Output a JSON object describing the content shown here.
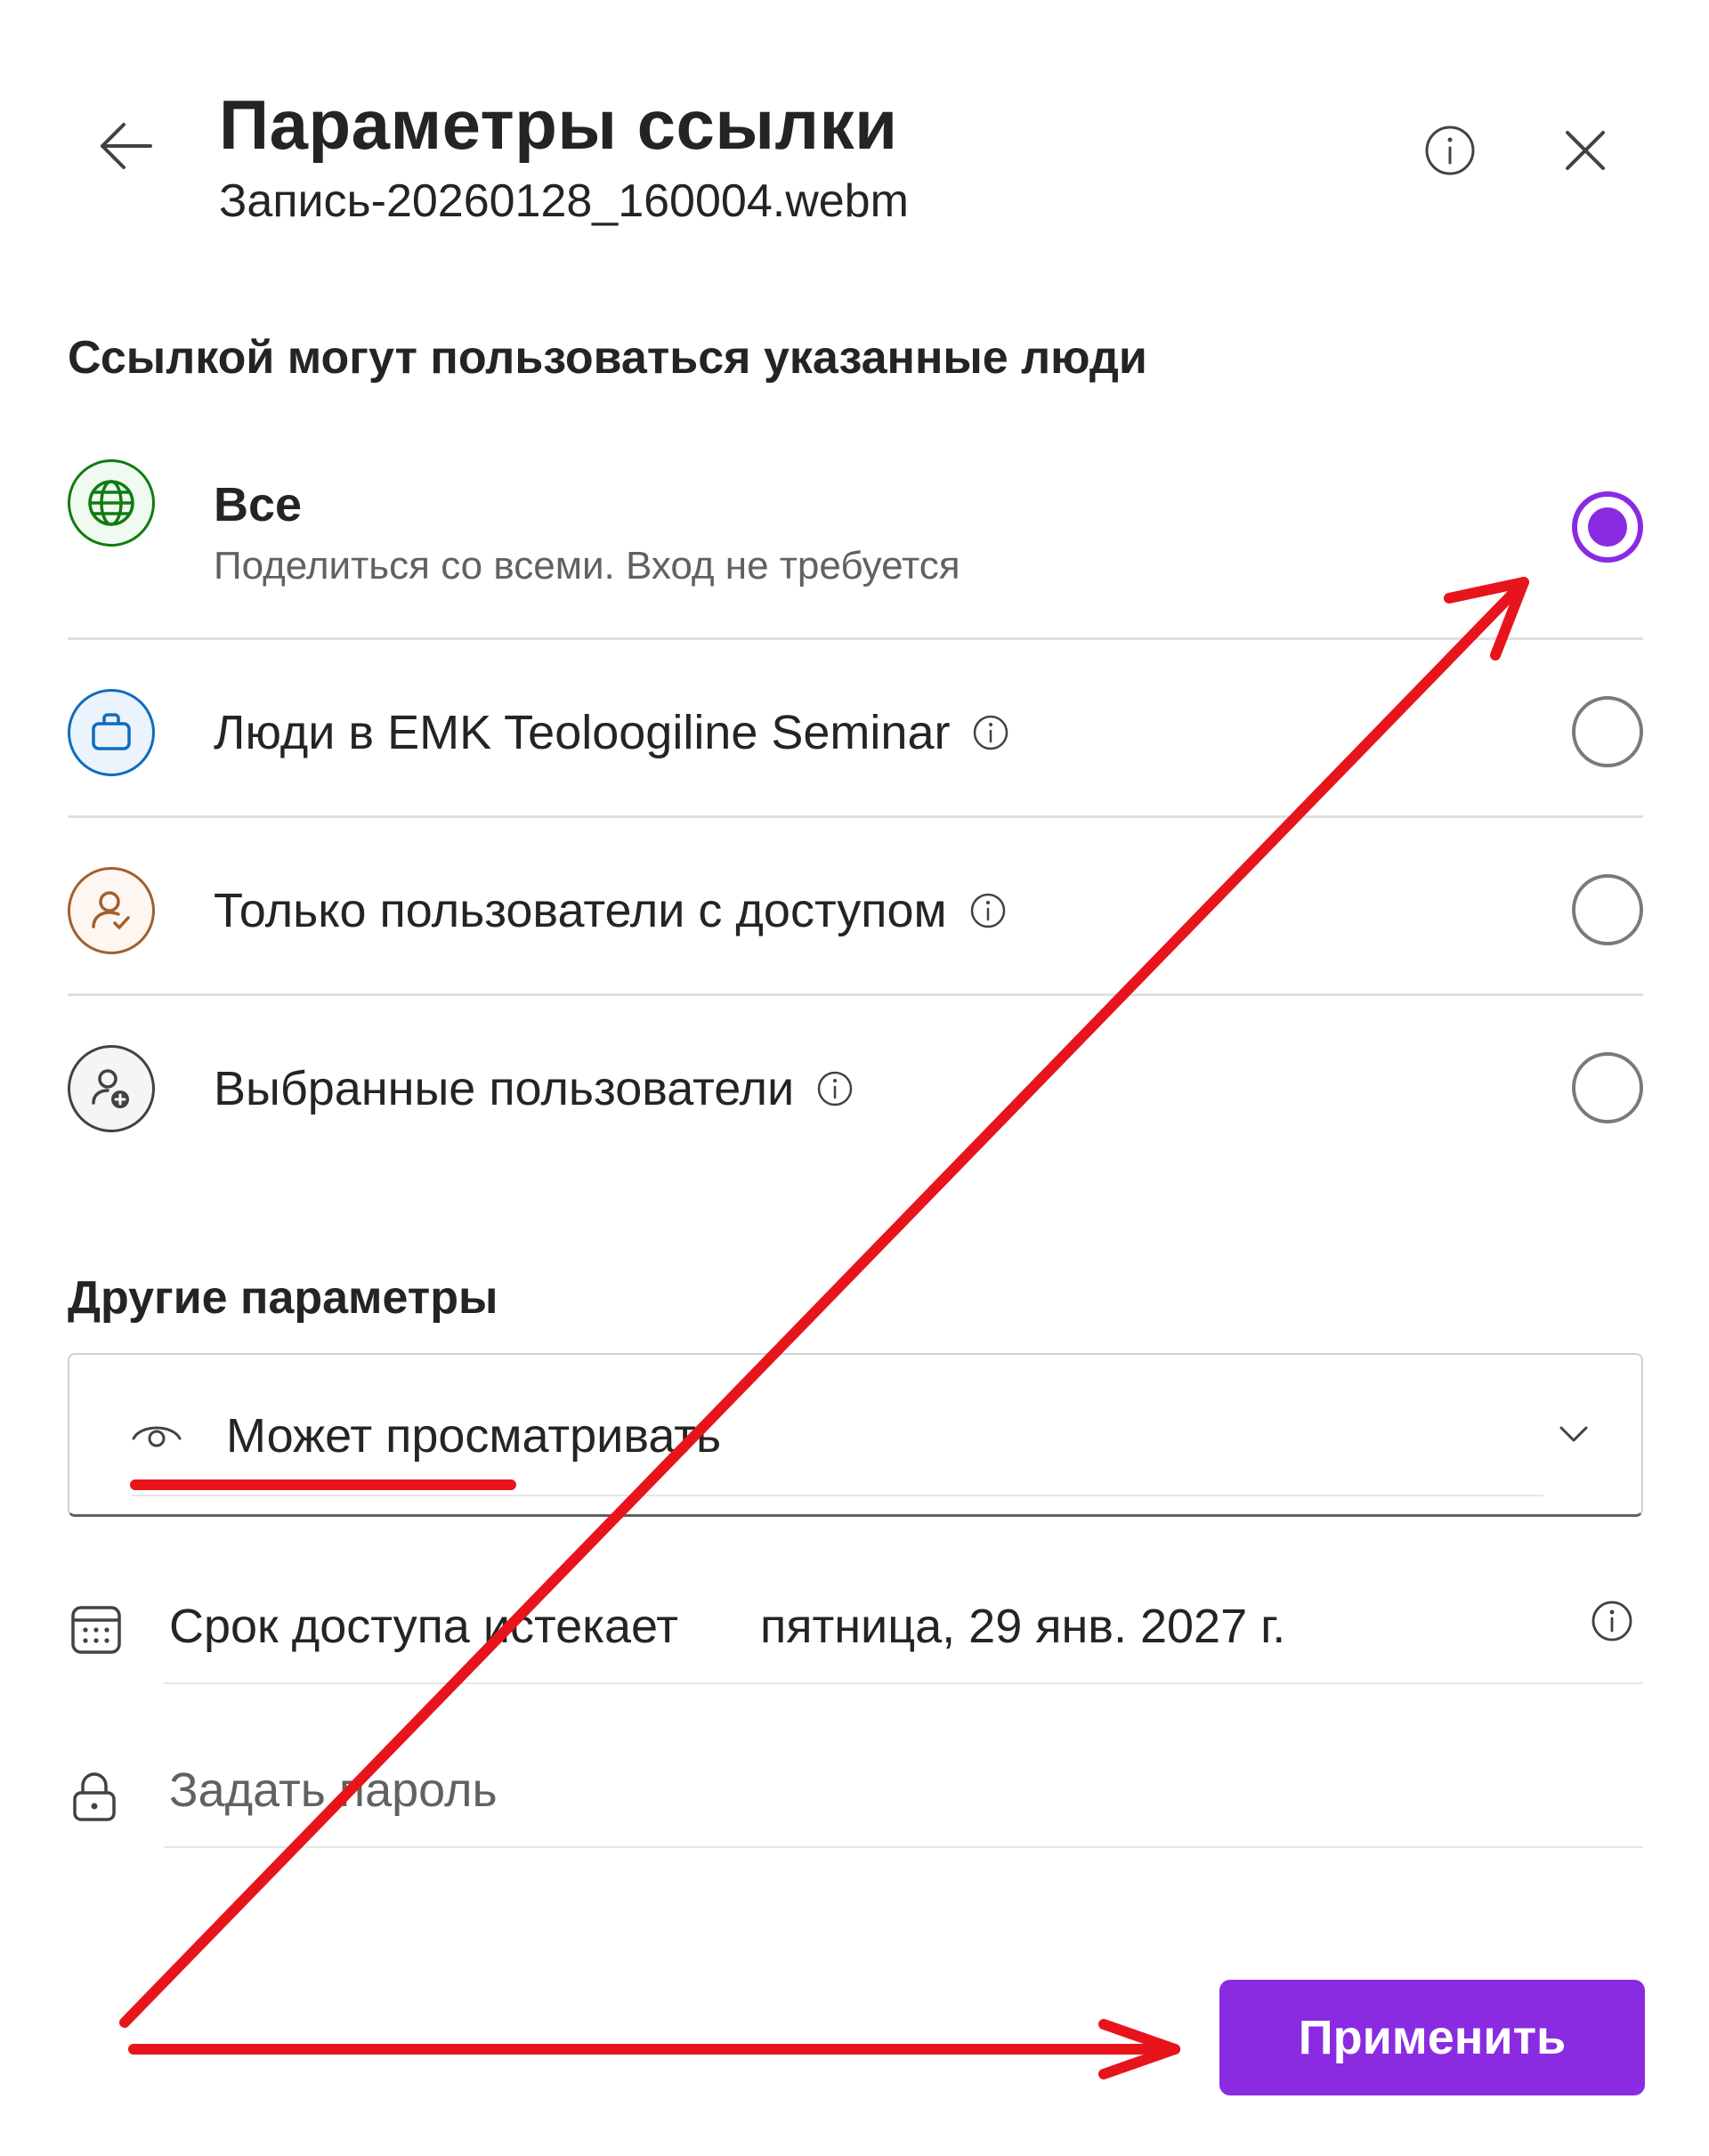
{
  "header": {
    "title": "Параметры ссылки",
    "filename": "Запись-20260128_160004.webm"
  },
  "link_scope": {
    "heading": "Ссылкой могут пользоваться указанные люди",
    "options": [
      {
        "label": "Все",
        "description": "Поделиться со всеми. Вход не требуется",
        "icon": "globe-icon",
        "selected": true
      },
      {
        "label": "Люди в EMK Teoloogiline Seminar",
        "icon": "briefcase-icon",
        "selected": false
      },
      {
        "label": "Только пользователи с доступом",
        "icon": "person-check-icon",
        "selected": false
      },
      {
        "label": "Выбранные пользователи",
        "icon": "person-add-icon",
        "selected": false
      }
    ]
  },
  "other_settings": {
    "heading": "Другие параметры",
    "permission": "Может просматривать",
    "expiry_label": "Срок доступа истекает",
    "expiry_value": "пятница, 29 янв. 2027 г.",
    "password_placeholder": "Задать пароль"
  },
  "apply_label": "Применить",
  "colors": {
    "accent": "#8a2be2",
    "annotation": "#e8141c",
    "globe": "#107c10",
    "briefcase": "#0f6cbd",
    "person_check": "#a35f2c",
    "person_add": "#424242"
  }
}
